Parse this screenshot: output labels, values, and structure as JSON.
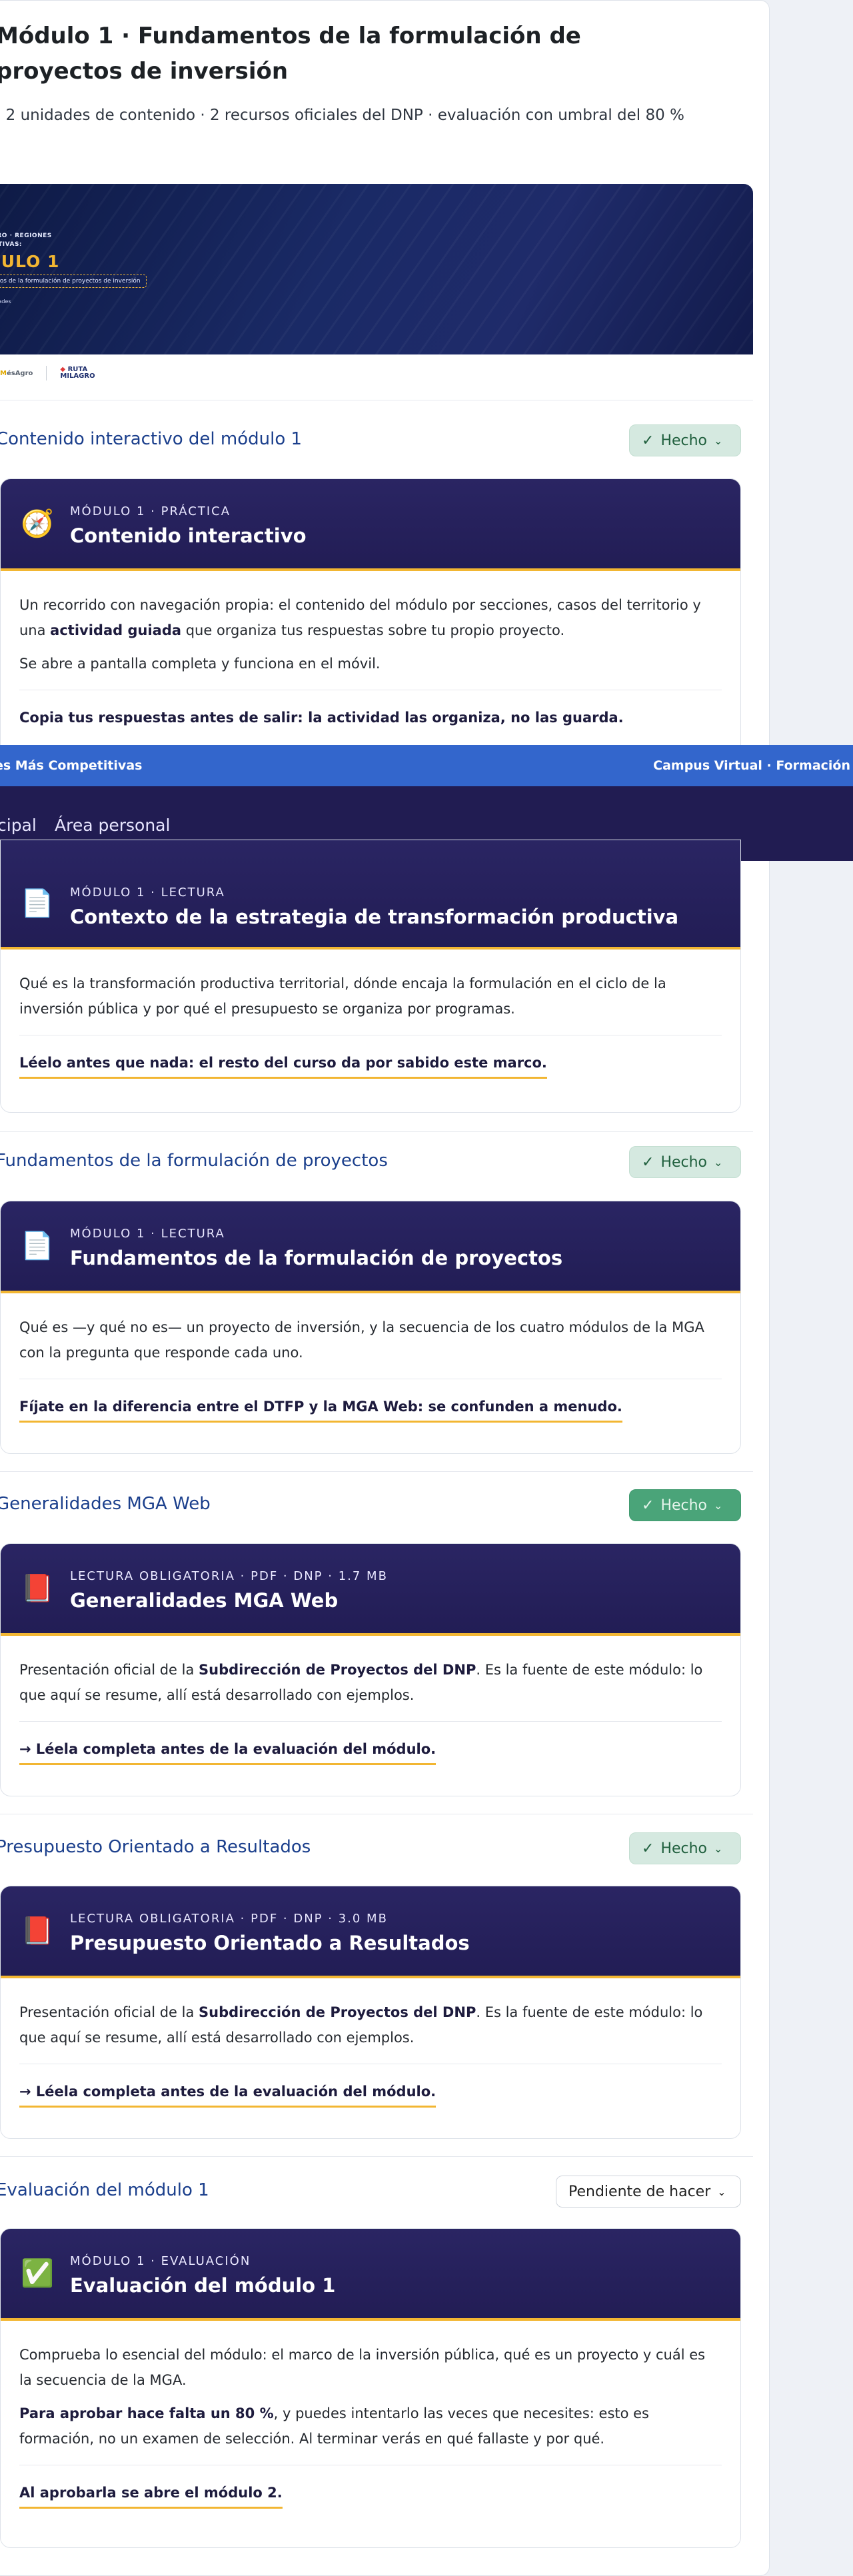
{
  "module": {
    "title": "Módulo 1 · Fundamentos de la formulación de proyectos de inversión",
    "subtitle": "· 2 unidades de contenido · 2 recursos oficiales del DNP · evaluación con umbral del 80 %"
  },
  "banner": {
    "kicker_line1": "AGRO · REGIONES",
    "kicker_line2": "ETITIVAS:",
    "module_label": "DULO 1",
    "tag": "entos de la formulación de proyectos de inversión",
    "units": "unidades"
  },
  "logos": {
    "left_a": "M",
    "left_b": "ésAgro",
    "right_line1": "RUTA",
    "right_line2": "MILAGRO"
  },
  "site": {
    "left_text": "es Más Competitivas",
    "right_text": "Campus Virtual · Formación"
  },
  "nav": {
    "items": [
      "cipal",
      "Área personal"
    ]
  },
  "sections": [
    {
      "title": "Contenido interactivo del módulo 1",
      "status": "Hecho",
      "icon": "compass-icon",
      "glyph": "🧭",
      "kicker": "MÓDULO 1 · PRÁCTICA",
      "card_title": "Contenido interactivo",
      "p1a": "Un recorrido con navegación propia: el contenido del módulo por secciones, casos del territorio y una ",
      "p1b": "actividad guiada",
      "p1c": " que organiza tus respuestas sobre tu propio proyecto.",
      "p2": "Se abre a pantalla completa y funciona en el móvil.",
      "note": "Copia tus respuestas antes de salir: la actividad las organiza, no las guarda."
    },
    {
      "icon": "document-icon",
      "glyph": "📄",
      "kicker": "MÓDULO 1 · LECTURA",
      "card_title": "Contexto de la estrategia de transformación productiva",
      "p1": "Qué es la transformación productiva territorial, dónde encaja la formulación en el ciclo de la inversión pública y por qué el presupuesto se organiza por programas.",
      "note": "Léelo antes que nada: el resto del curso da por sabido este marco."
    },
    {
      "title": "Fundamentos de la formulación de proyectos",
      "status": "Hecho",
      "icon": "document-icon",
      "glyph": "📄",
      "kicker": "MÓDULO 1 · LECTURA",
      "card_title": "Fundamentos de la formulación de proyectos",
      "p1": "Qué es —y qué no es— un proyecto de inversión, y la secuencia de los cuatro módulos de la MGA con la pregunta que responde cada uno.",
      "note": "Fíjate en la diferencia entre el DTFP y la MGA Web: se confunden a menudo."
    },
    {
      "title": "Generalidades MGA Web",
      "status": "Hecho",
      "icon": "pdf-book-icon",
      "glyph": "📕",
      "kicker": "LECTURA OBLIGATORIA · PDF · DNP · 1.7 MB",
      "card_title": "Generalidades MGA Web",
      "p1a": "Presentación oficial de la ",
      "p1b": "Subdirección de Proyectos del DNP",
      "p1c": ". Es la fuente de este módulo: lo que aquí se resume, allí está desarrollado con ejemplos.",
      "note": "→ Léela completa antes de la evaluación del módulo."
    },
    {
      "title": "Presupuesto Orientado a Resultados",
      "status": "Hecho",
      "icon": "pdf-book-icon",
      "glyph": "📕",
      "kicker": "LECTURA OBLIGATORIA · PDF · DNP · 3.0 MB",
      "card_title": "Presupuesto Orientado a Resultados",
      "p1a": "Presentación oficial de la ",
      "p1b": "Subdirección de Proyectos del DNP",
      "p1c": ". Es la fuente de este módulo: lo que aquí se resume, allí está desarrollado con ejemplos.",
      "note": "→ Léela completa antes de la evaluación del módulo."
    },
    {
      "title": "Evaluación del módulo 1",
      "status": "Pendiente de hacer",
      "icon": "checkmark-icon",
      "glyph": "✅",
      "kicker": "MÓDULO 1 · EVALUACIÓN",
      "card_title": "Evaluación del módulo 1",
      "p1": "Comprueba lo esencial del módulo: el marco de la inversión pública, qué es un proyecto y cuál es la secuencia de la MGA.",
      "p2a": "Para aprobar hace falta un 80 %",
      "p2b": ", y puedes intentarlo las veces que necesites: esto es formación, no un examen de selección. Al terminar verás en qué fallaste y por qué.",
      "note": "Al aprobarla se abre el módulo 2."
    }
  ],
  "colors": {
    "brand_blue": "#3366cc",
    "nav_dark": "#211c52",
    "accent_gold": "#f2b632",
    "section_title": "#1b3f8c",
    "done_green": "#d5e9e0"
  }
}
